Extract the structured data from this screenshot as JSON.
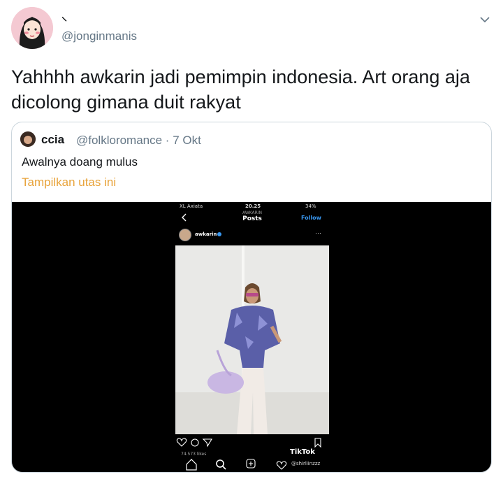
{
  "tweet": {
    "display_name": "⸜",
    "handle": "@jonginmanis",
    "text": "Yahhhh awkarin jadi pemimpin indonesia. Art orang aja dicolong gimana duit rakyat"
  },
  "quoted": {
    "name": "ccia",
    "meta": "@folkloromance · 7 Okt",
    "text": "Awalnya doang mulus",
    "thread_link": "Tampilkan utas ini"
  },
  "media": {
    "status_bar": {
      "carrier": "XL Axiata",
      "time": "20.25",
      "battery": "34%"
    },
    "ig_header": {
      "subtitle": "AWKARIN",
      "title": "Posts",
      "follow": "Follow"
    },
    "post_user": "awkarin",
    "likes": "74.573 likes",
    "tiktok": {
      "brand": "TikTok",
      "user": "@shirliinzzz"
    }
  },
  "colors": {
    "link": "#e8a33a",
    "secondary_text": "#657786",
    "border": "#ccd6dd",
    "ig_blue": "#3897f0"
  },
  "icons": [
    "chevron-down-icon",
    "back-chevron-icon",
    "heart-icon",
    "comment-icon",
    "share-icon",
    "bookmark-icon",
    "home-icon",
    "search-icon",
    "add-post-icon",
    "tiktok-logo-icon"
  ]
}
